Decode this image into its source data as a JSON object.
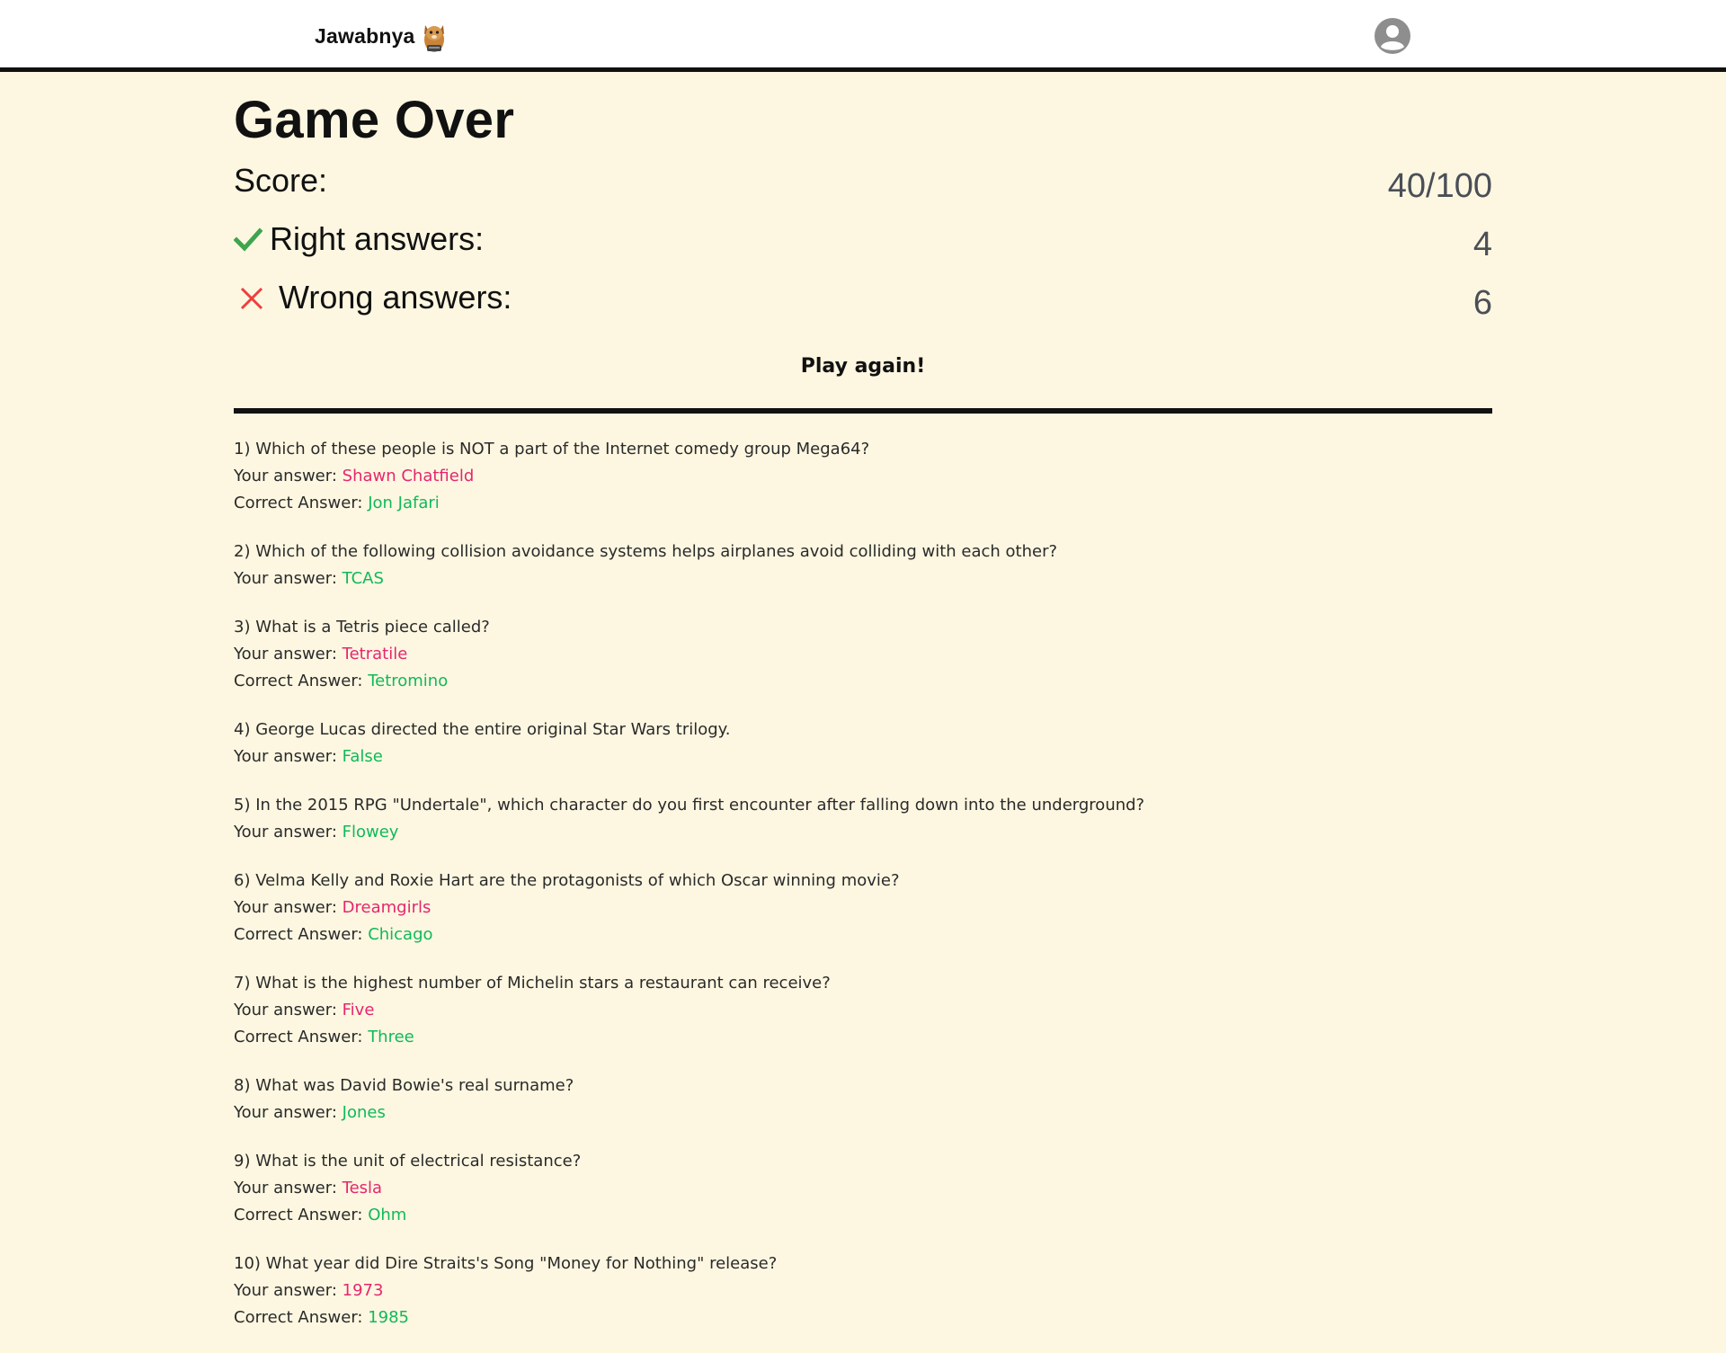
{
  "header": {
    "brand_name": "Jawabnya",
    "logo_icon": "fox-logo-icon",
    "avatar_icon": "user-avatar-icon"
  },
  "summary": {
    "title": "Game Over",
    "score_label": "Score:",
    "score_value": "40/100",
    "right_label": "Right answers:",
    "right_value": "4",
    "wrong_label": "Wrong answers:",
    "wrong_value": "6",
    "play_again": "Play again!"
  },
  "labels": {
    "your_answer": "Your answer: ",
    "correct_answer": "Correct Answer: "
  },
  "colors": {
    "background": "#fdf7e1",
    "wrong": "#e6266e",
    "right": "#10b95a"
  },
  "questions": [
    {
      "q": "1) Which of these people is NOT a part of the Internet comedy group Mega64?",
      "your": "Shawn Chatfield",
      "correct": "Jon Jafari",
      "is_correct": false
    },
    {
      "q": "2) Which of the following collision avoidance systems helps airplanes avoid colliding with each other?",
      "your": "TCAS",
      "correct": null,
      "is_correct": true
    },
    {
      "q": "3) What is a Tetris piece called?",
      "your": "Tetratile",
      "correct": "Tetromino",
      "is_correct": false
    },
    {
      "q": "4) George Lucas directed the entire original Star Wars trilogy.",
      "your": "False",
      "correct": null,
      "is_correct": true
    },
    {
      "q": "5) In the 2015 RPG \"Undertale\", which character do you first encounter after falling down into the underground?",
      "your": "Flowey",
      "correct": null,
      "is_correct": true
    },
    {
      "q": "6) Velma Kelly and Roxie Hart are the protagonists of which Oscar winning movie?",
      "your": "Dreamgirls",
      "correct": "Chicago",
      "is_correct": false
    },
    {
      "q": "7) What is the highest number of Michelin stars a restaurant can receive?",
      "your": "Five",
      "correct": "Three",
      "is_correct": false
    },
    {
      "q": "8) What was David Bowie's real surname?",
      "your": "Jones",
      "correct": null,
      "is_correct": true
    },
    {
      "q": "9) What is the unit of electrical resistance?",
      "your": "Tesla",
      "correct": "Ohm",
      "is_correct": false
    },
    {
      "q": "10) What year did Dire Straits's Song \"Money for Nothing\" release?",
      "your": "1973",
      "correct": "1985",
      "is_correct": false
    }
  ]
}
